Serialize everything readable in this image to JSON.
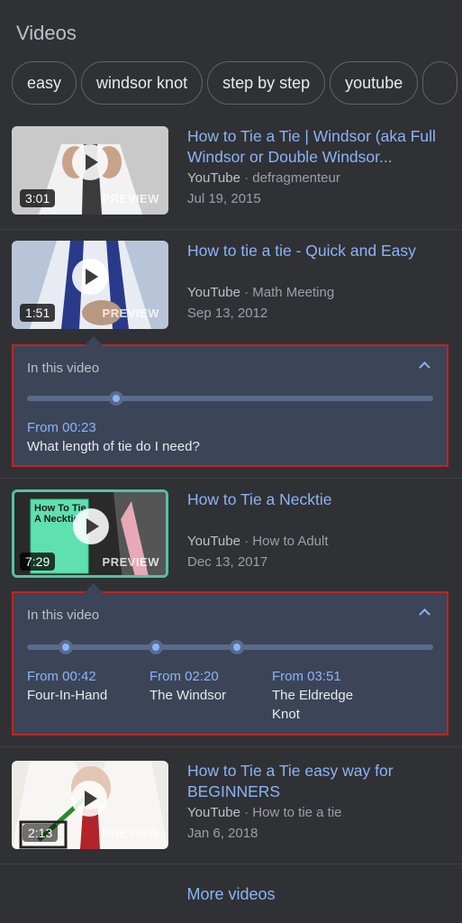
{
  "section_title": "Videos",
  "chips": [
    "easy",
    "windsor knot",
    "step by step",
    "youtube"
  ],
  "videos": [
    {
      "title": "How to Tie a Tie | Windsor (aka Full Windsor or Double Windsor...",
      "source": "YouTube",
      "channel": "defragmenteur",
      "date": "Jul 19, 2015",
      "duration": "3:01",
      "preview": "PREVIEW"
    },
    {
      "title": "How to tie a tie - Quick and Easy",
      "source": "YouTube",
      "channel": "Math Meeting",
      "date": "Sep 13, 2012",
      "duration": "1:51",
      "preview": "PREVIEW"
    },
    {
      "title": "How to Tie a Necktie",
      "source": "YouTube",
      "channel": "How to Adult",
      "date": "Dec 13, 2017",
      "duration": "7:29",
      "preview": "PREVIEW",
      "thumb_text": "How To Tie A Necktie"
    },
    {
      "title": "How to Tie a Tie easy way for BEGINNERS",
      "source": "YouTube",
      "channel": "How to tie a tie",
      "date": "Jan 6, 2018",
      "duration": "2:13",
      "preview": "PREVIEW"
    }
  ],
  "key_moments": [
    {
      "heading": "In this video",
      "moments": [
        {
          "time": "From 00:23",
          "label": "What length of tie do I need?"
        }
      ]
    },
    {
      "heading": "In this video",
      "moments": [
        {
          "time": "From 00:42",
          "label": "Four-In-Hand"
        },
        {
          "time": "From 02:20",
          "label": "The Windsor"
        },
        {
          "time": "From 03:51",
          "label": "The Eldredge Knot"
        }
      ]
    }
  ],
  "more_videos": "More videos",
  "colors": {
    "background": "#303134",
    "link": "#8ab4f8",
    "highlight_border": "#c5221f",
    "panel": "#3c4457"
  }
}
